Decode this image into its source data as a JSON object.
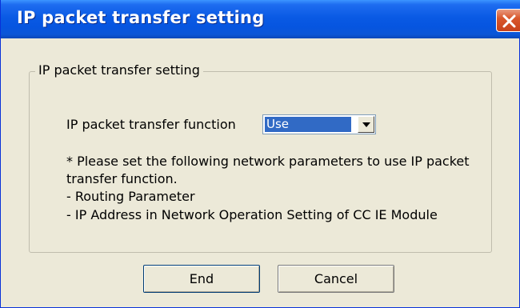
{
  "window": {
    "title": "IP packet transfer setting"
  },
  "group": {
    "legend": "IP packet transfer setting",
    "function_label": "IP packet transfer function",
    "function_select": {
      "value": "Use"
    },
    "notes": [
      "* Please set the following network parameters to use IP packet",
      "transfer function.",
      "- Routing Parameter",
      "- IP Address in Network Operation Setting of CC IE Module"
    ]
  },
  "buttons": {
    "end": "End",
    "cancel": "Cancel"
  },
  "colors": {
    "titlebar": "#0a5ae4",
    "close": "#d9572c",
    "selection": "#316ac5",
    "background": "#ece9d8"
  },
  "icons": {
    "close": "close-icon",
    "dropdown": "chevron-down-icon"
  }
}
